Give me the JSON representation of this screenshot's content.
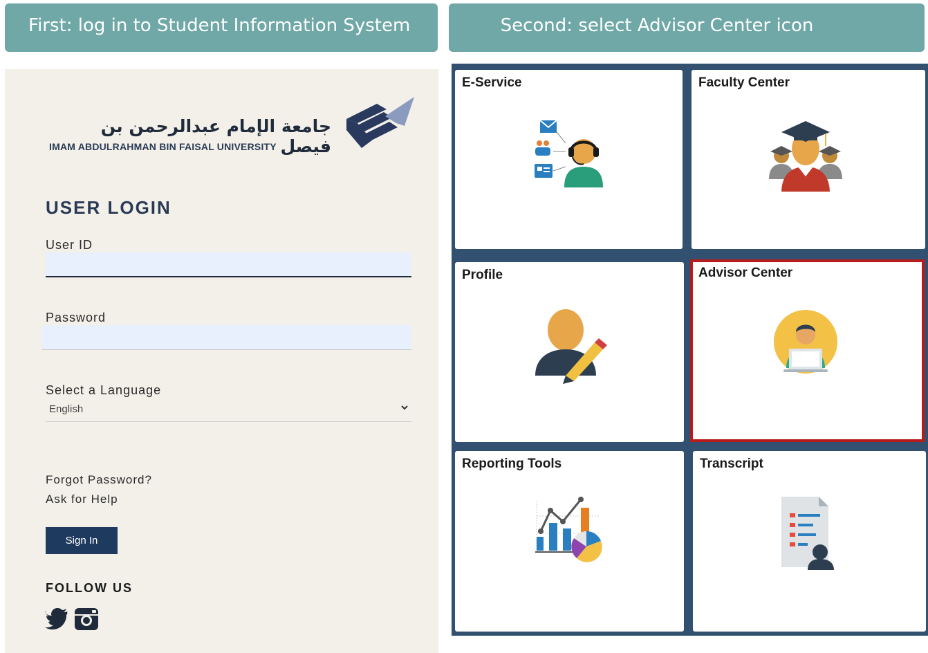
{
  "banners": {
    "first": "First: log in to Student Information System",
    "second": "Second: select Advisor Center icon"
  },
  "login": {
    "logo_arabic": "جامعة الإمام عبدالرحمن بن فيصل",
    "logo_english": "IMAM ABDULRAHMAN BIN FAISAL UNIVERSITY",
    "title": "USER LOGIN",
    "userid_label": "User ID",
    "userid_value": "",
    "password_label": "Password",
    "password_value": "",
    "language_label": "Select a Language",
    "language_selected": "English",
    "forgot_password": "Forgot Password?",
    "ask_help": "Ask for Help",
    "signin_label": "Sign In",
    "follow_us": "FOLLOW US",
    "social_icons": [
      "twitter-icon",
      "instagram-icon"
    ]
  },
  "tiles": [
    {
      "label": "E-Service",
      "icon": "e-service-icon",
      "selected": false
    },
    {
      "label": "Faculty Center",
      "icon": "faculty-center-icon",
      "selected": false
    },
    {
      "label": "Profile",
      "icon": "profile-icon",
      "selected": false
    },
    {
      "label": "Advisor Center",
      "icon": "advisor-center-icon",
      "selected": true
    },
    {
      "label": "Reporting Tools",
      "icon": "reporting-tools-icon",
      "selected": false
    },
    {
      "label": "Transcript",
      "icon": "transcript-icon",
      "selected": false
    }
  ],
  "colors": {
    "banner": "#6fa8a6",
    "login_bg": "#f2f0e9",
    "navy": "#1f3a5f",
    "tiles_bg": "#32506f",
    "highlight": "#b71c1c"
  }
}
